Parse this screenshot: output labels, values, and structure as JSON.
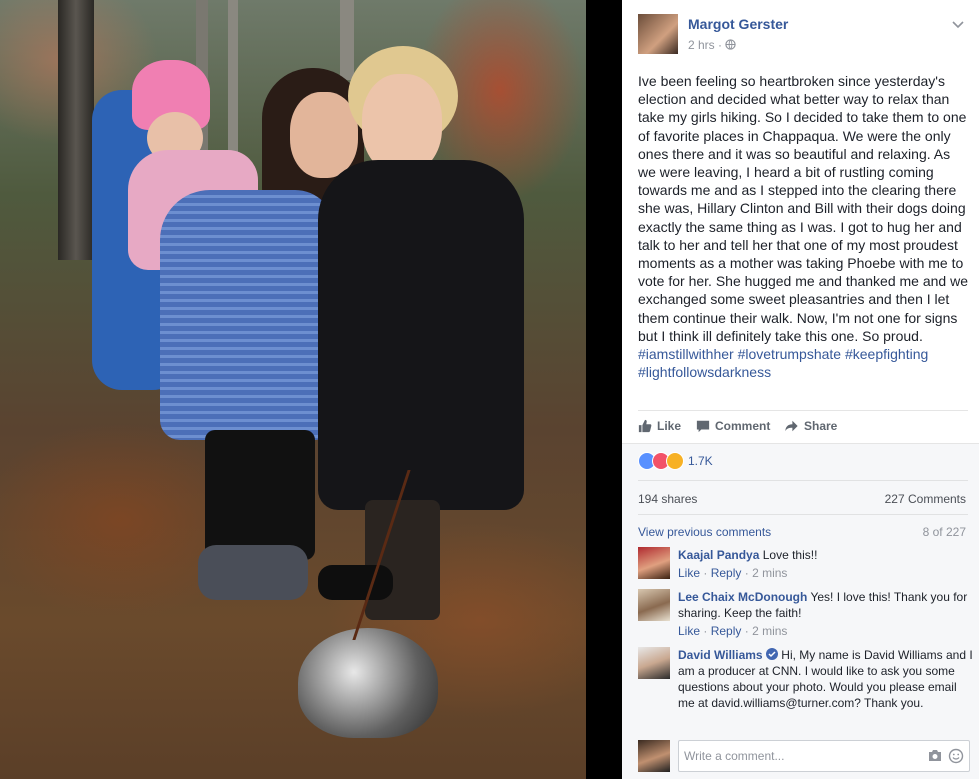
{
  "post": {
    "author": "Margot Gerster",
    "time": "2 hrs",
    "separator": "·",
    "text": "Ive been feeling so heartbroken since yesterday's election and decided what better way to relax than take my girls hiking. So I decided to take them to one of favorite places in Chappaqua. We were the only ones there and it was so beautiful and relaxing. As we were leaving, I heard a bit of rustling coming towards me and as I stepped into the clearing there she was, Hillary Clinton and Bill with their dogs doing exactly the same thing as I was. I got to hug her and talk to her and tell her that one of my most proudest moments as a mother was taking Phoebe with me to vote for her. She hugged me and thanked me and we exchanged some sweet pleasantries and then I let them continue their walk. Now, I'm not one for signs but I think ill definitely take this one. So proud.",
    "hashtags": "#iamstillwithher #lovetrumpshate #keepfighting #lightfollowsdarkness"
  },
  "actions": {
    "like": "Like",
    "comment": "Comment",
    "share": "Share"
  },
  "reactions": {
    "count": "1.7K"
  },
  "stats": {
    "shares": "194 shares",
    "comments": "227 Comments"
  },
  "comments_nav": {
    "view_previous": "View previous comments",
    "count": "8 of 227"
  },
  "comments": [
    {
      "name": "Kaajal Pandya",
      "text": "Love this!!",
      "like": "Like",
      "dot": "·",
      "reply": "Reply",
      "time": "2 mins"
    },
    {
      "name": "Lee Chaix McDonough",
      "text": "Yes! I love this! Thank you for sharing. Keep the faith!",
      "like": "Like",
      "dot": "·",
      "reply": "Reply",
      "time": "2 mins"
    },
    {
      "name": "David Williams",
      "text": "Hi, My name is David Williams and I am a producer at CNN. I would like to ask you some questions about your photo. Would you please email me at david.williams@turner.com? Thank you."
    }
  ],
  "write": {
    "placeholder": "Write a comment..."
  },
  "colors": {
    "link": "#365899",
    "like_reaction": "#5890ff",
    "love_reaction": "#f25268",
    "wow_reaction": "#f7b125"
  },
  "icons": [
    "chevron-down-icon",
    "globe-icon",
    "like-icon",
    "comment-icon",
    "share-icon",
    "camera-icon",
    "emoji-icon",
    "verified-icon"
  ]
}
